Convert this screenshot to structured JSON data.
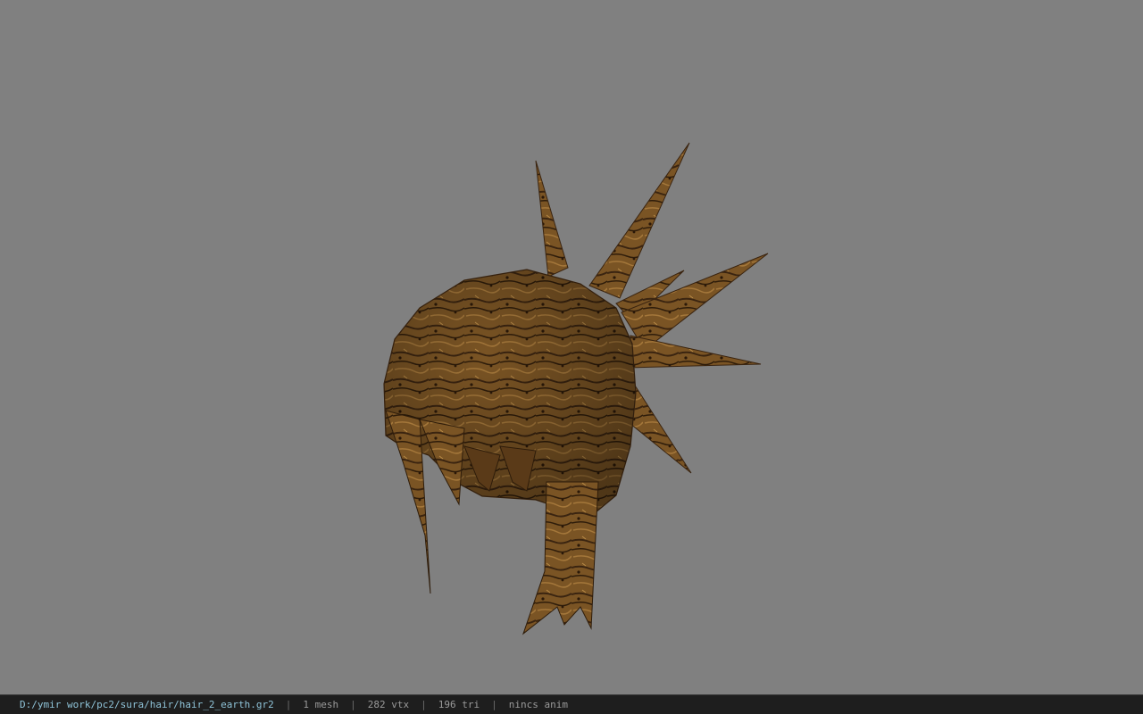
{
  "viewport": {
    "background": "#808080",
    "model_icon": "hair-mesh-model"
  },
  "status_bar": {
    "file_path": "D:/ymir work/pc2/sura/hair/hair_2_earth.gr2",
    "mesh_count": "1 mesh",
    "vertex_count": "282 vtx",
    "triangle_count": "196 tri",
    "animation": "nincs anim",
    "separator": "|"
  }
}
